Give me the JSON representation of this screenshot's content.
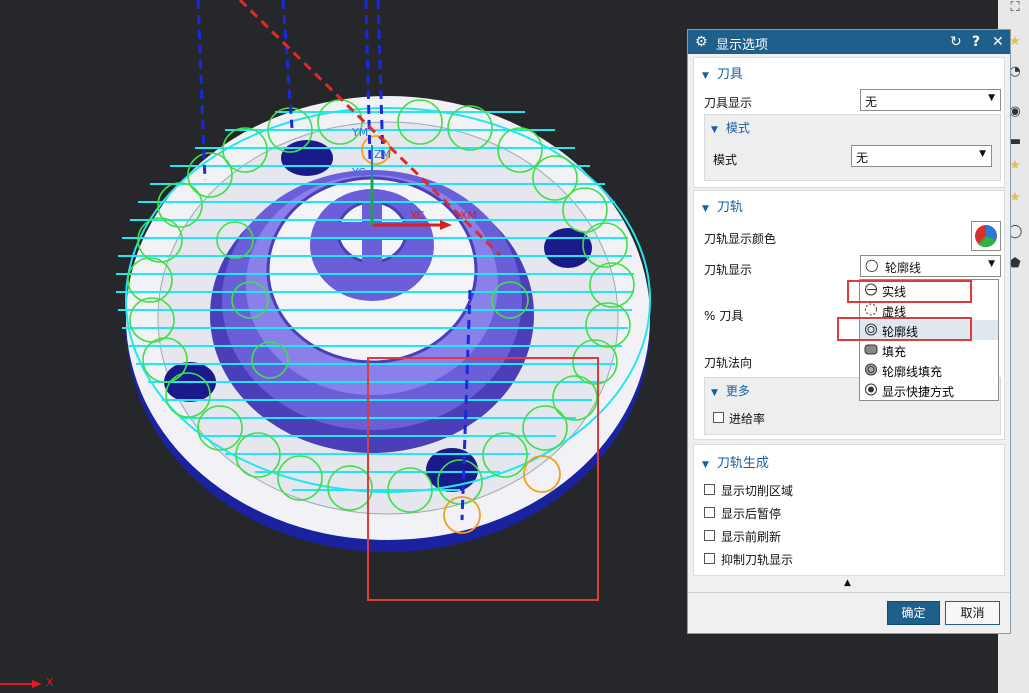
{
  "viewport": {
    "labels": {
      "ym_top": "YM",
      "xc": "XC",
      "xm": "XM",
      "yc": "YC",
      "zm": "ZM",
      "global_x": "X"
    }
  },
  "dialog": {
    "title": "显示选项",
    "tool_section": {
      "title": "刀具",
      "tool_display_label": "刀具显示",
      "tool_display_value": "无",
      "mode_section": {
        "title": "模式",
        "mode_label": "模式",
        "mode_value": "无"
      }
    },
    "path_section": {
      "title": "刀轨",
      "color_label": "刀轨显示颜色",
      "display_label": "刀轨显示",
      "display_value": "轮廓线",
      "tool_percent_label": "% 刀具",
      "normal_label": "刀轨法向",
      "more_section": {
        "title": "更多",
        "feed_rate_label": "进给率"
      }
    },
    "dropdown": {
      "options": [
        "实线",
        "虚线",
        "轮廓线",
        "填充",
        "轮廓线填充",
        "显示快捷方式"
      ]
    },
    "generate_section": {
      "title": "刀轨生成",
      "options": [
        "显示切削区域",
        "显示后暂停",
        "显示前刷新",
        "抑制刀轨显示"
      ]
    },
    "buttons": {
      "ok": "确定",
      "cancel": "取消"
    }
  },
  "colors": {
    "title_bar": "#1f5f8b",
    "accent": "#1a5fa0",
    "highlight": "#e03a3a",
    "part": "#6a5fd8",
    "path_cyan": "#22e6f0",
    "path_green": "#3fe04a"
  }
}
